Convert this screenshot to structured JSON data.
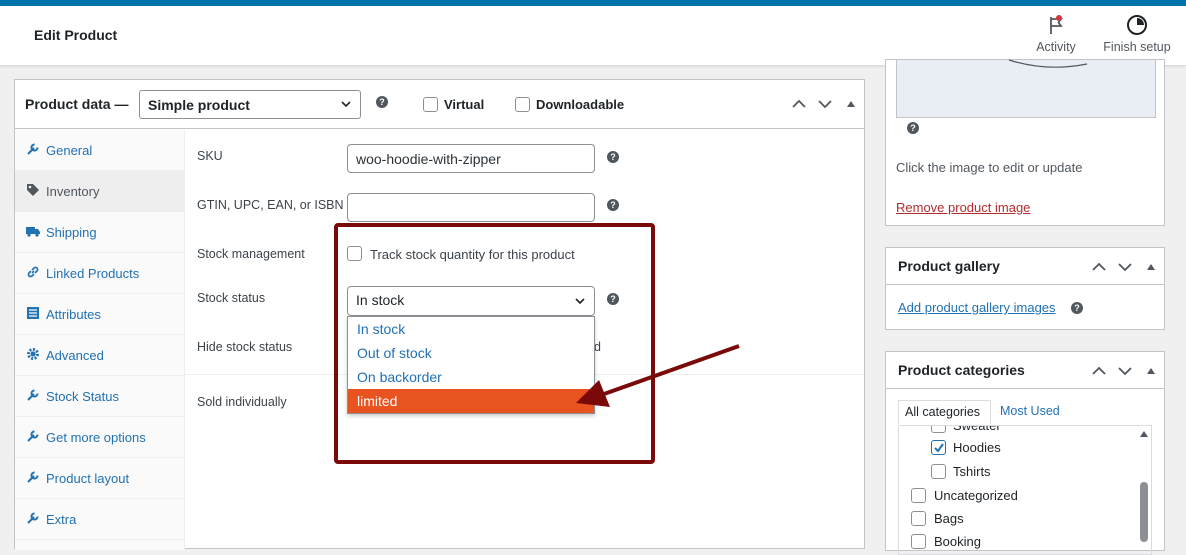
{
  "header": {
    "title": "Edit Product",
    "activity_label": "Activity",
    "finish_label": "Finish setup"
  },
  "product_data": {
    "title": "Product data —",
    "type_value": "Simple product",
    "virtual_label": "Virtual",
    "downloadable_label": "Downloadable"
  },
  "tabs": [
    {
      "label": "General",
      "icon": "wrench-icon"
    },
    {
      "label": "Inventory",
      "icon": "tag-icon"
    },
    {
      "label": "Shipping",
      "icon": "truck-icon"
    },
    {
      "label": "Linked Products",
      "icon": "link-icon"
    },
    {
      "label": "Attributes",
      "icon": "list-icon"
    },
    {
      "label": "Advanced",
      "icon": "gear-icon"
    },
    {
      "label": "Stock Status",
      "icon": "wrench-icon"
    },
    {
      "label": "Get more options",
      "icon": "wrench-icon"
    },
    {
      "label": "Product layout",
      "icon": "wrench-icon"
    },
    {
      "label": "Extra",
      "icon": "wrench-icon"
    }
  ],
  "inventory": {
    "sku_label": "SKU",
    "sku_value": "woo-hoodie-with-zipper",
    "gtin_label": "GTIN, UPC, EAN, or ISBN",
    "gtin_value": "",
    "stock_mgmt_label": "Stock management",
    "track_label": "Track stock quantity for this product",
    "stock_status_label": "Stock status",
    "stock_status_value": "In stock",
    "hide_label": "Hide stock status",
    "hide_partial": "d",
    "sold_label": "Sold individually"
  },
  "dropdown_options": [
    "In stock",
    "Out of stock",
    "On backorder",
    "limited"
  ],
  "sidebar": {
    "image_hint": "Click the image to edit or update",
    "remove_image": "Remove product image",
    "gallery_title": "Product gallery",
    "gallery_add": "Add product gallery images",
    "categories_title": "Product categories",
    "tab_all": "All categories",
    "tab_most_used": "Most Used",
    "categories": [
      {
        "label": "Sweater",
        "checked": false
      },
      {
        "label": "Hoodies",
        "checked": true
      },
      {
        "label": "Tshirts",
        "checked": false
      },
      {
        "label": "Uncategorized",
        "checked": false
      },
      {
        "label": "Bags",
        "checked": false
      },
      {
        "label": "Booking",
        "checked": false
      }
    ]
  },
  "colors": {
    "accent": "#2271b1",
    "highlight_option": "#e8531f",
    "annotation": "#7a0a0a"
  }
}
